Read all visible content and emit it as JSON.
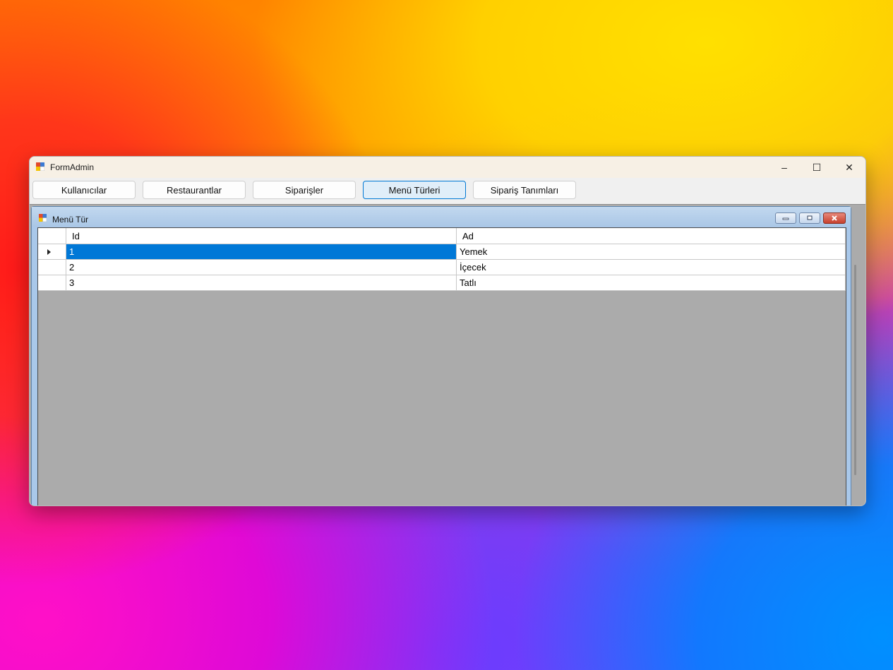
{
  "window": {
    "title": "FormAdmin",
    "controls": {
      "minimize": "–",
      "maximize": "☐",
      "close": "✕"
    }
  },
  "toolbar": {
    "buttons": [
      {
        "label": "Kullanıcılar",
        "active": false
      },
      {
        "label": "Restaurantlar",
        "active": false
      },
      {
        "label": "Siparişler",
        "active": false
      },
      {
        "label": "Menü Türleri",
        "active": true
      },
      {
        "label": "Sipariş Tanımları",
        "active": false
      }
    ]
  },
  "child": {
    "title": "Menü Tür",
    "grid": {
      "columns": [
        "Id",
        "Ad"
      ],
      "rows": [
        {
          "id": "1",
          "ad": "Yemek",
          "selected": true
        },
        {
          "id": "2",
          "ad": "İçecek",
          "selected": false
        },
        {
          "id": "3",
          "ad": "Tatlı",
          "selected": false
        }
      ]
    }
  },
  "colors": {
    "selection": "#0078d7",
    "active_button_border": "#0078d4",
    "mdi_background": "#ababab"
  }
}
